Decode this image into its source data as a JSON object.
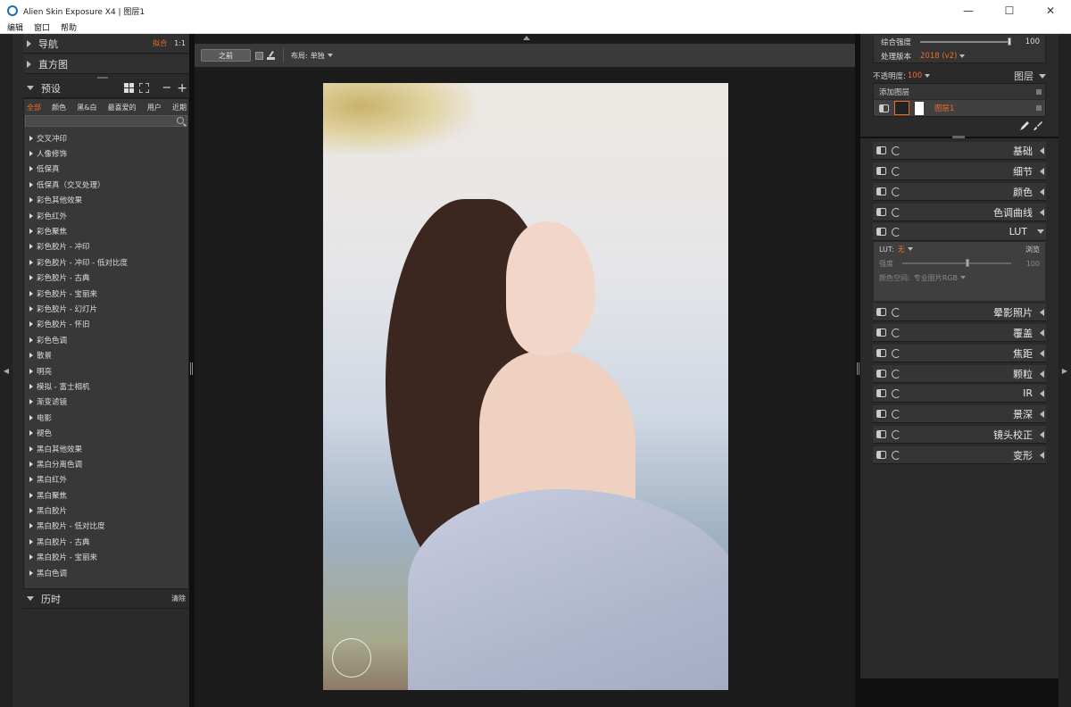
{
  "window": {
    "title": "Alien Skin Exposure X4 | 图层1",
    "minimize": "—",
    "maximize": "☐",
    "close": "✕"
  },
  "menu": [
    "编辑",
    "窗口",
    "帮助"
  ],
  "left": {
    "navigator": {
      "label": "导航",
      "fit": "拟合",
      "zoom": "1:1"
    },
    "histogram": {
      "label": "直方图"
    },
    "presets": {
      "label": "预设",
      "minus": "−",
      "plus": "+",
      "tabs": [
        "全部",
        "颜色",
        "黑&白",
        "最喜爱的",
        "用户",
        "近期"
      ],
      "items": [
        "交叉冲印",
        "人像修饰",
        "低保真",
        "低保真（交叉处理）",
        "彩色其他效果",
        "彩色红外",
        "彩色聚焦",
        "彩色胶片 - 冲印",
        "彩色胶片 - 冲印 - 低对比度",
        "彩色胶片 - 古典",
        "彩色胶片 - 宝丽来",
        "彩色胶片 - 幻灯片",
        "彩色胶片 - 怀旧",
        "彩色色调",
        "散景",
        "明亮",
        "模拟 - 富士相机",
        "渐变滤镜",
        "电影",
        "褪色",
        "黑白其他效果",
        "黑白分离色调",
        "黑白红外",
        "黑白聚焦",
        "黑白胶片",
        "黑白胶片 - 低对比度",
        "黑白胶片 - 古典",
        "黑白胶片 - 宝丽来",
        "黑白色调"
      ]
    },
    "history": {
      "label": "历时",
      "clear": "清除"
    }
  },
  "center": {
    "before_label": "之前",
    "layout_label": "布局:",
    "layout_value": "单独"
  },
  "right": {
    "overall_strength_label": "综合强度",
    "overall_strength_value": "100",
    "overall_strength": 1.0,
    "process_version_label": "处理版本",
    "process_version_value": "2018 (v2)",
    "opacity_label": "不透明度:",
    "opacity_value": "100",
    "layers_label": "图层",
    "add_layer": "添加图层",
    "layer_name": "图层1",
    "sections": [
      "基础",
      "细节",
      "颜色",
      "色调曲线",
      "LUT",
      "晕影照片",
      "覆盖",
      "焦距",
      "颗粒",
      "IR",
      "景深",
      "镜头校正",
      "变形"
    ],
    "lut": {
      "lut_label": "LUT:",
      "lut_value": "无",
      "browse": "浏览",
      "strength_label": "强度",
      "strength_value": "100",
      "strength": 0.6,
      "colorspace_label": "颜色空间:",
      "colorspace_value": "专业图片RGB"
    }
  },
  "colors": {
    "accent": "#f06a2a",
    "panel": "#2a2a2a",
    "background": "#101010"
  }
}
